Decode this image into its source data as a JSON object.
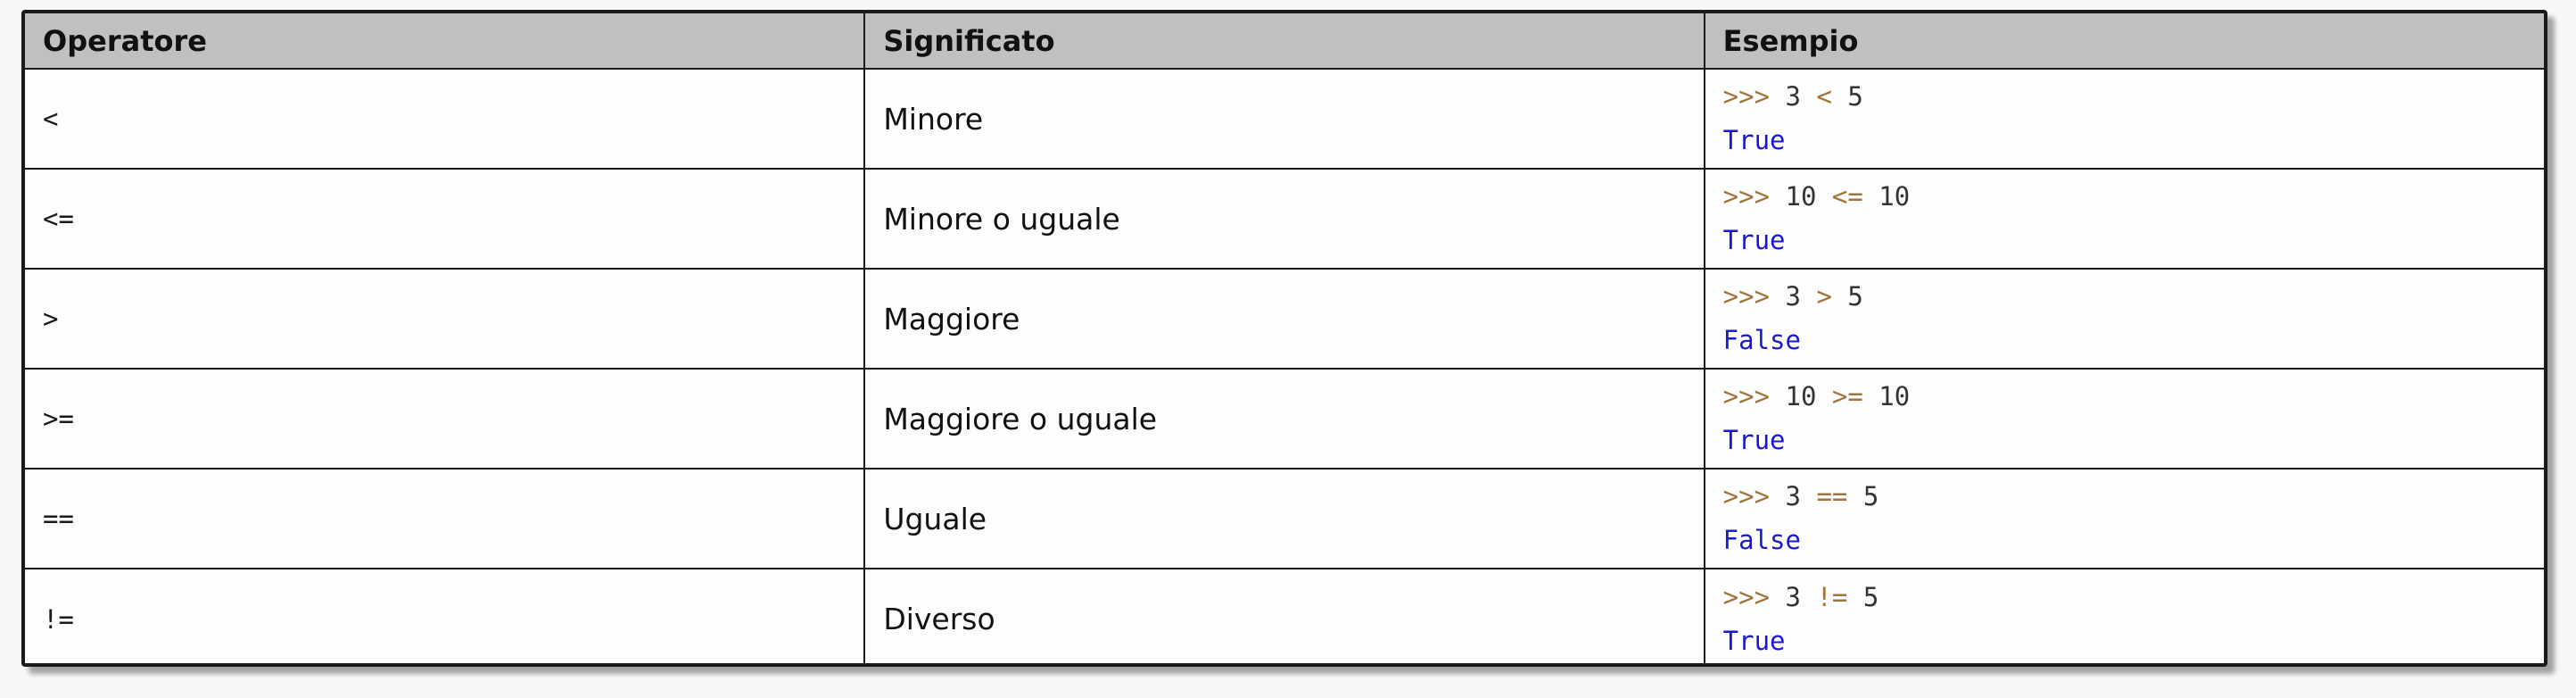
{
  "table": {
    "headers": [
      "Operatore",
      "Significato",
      "Esempio"
    ],
    "rows": [
      {
        "operator": "<",
        "meaning": "Minore",
        "prompt": ">>>",
        "left": "3",
        "op": "<",
        "right": "5",
        "result": "True"
      },
      {
        "operator": "<=",
        "meaning": "Minore o uguale",
        "prompt": ">>>",
        "left": "10",
        "op": "<=",
        "right": "10",
        "result": "True"
      },
      {
        "operator": ">",
        "meaning": "Maggiore",
        "prompt": ">>>",
        "left": "3",
        "op": ">",
        "right": "5",
        "result": "False"
      },
      {
        "operator": ">=",
        "meaning": "Maggiore o uguale",
        "prompt": ">>>",
        "left": "10",
        "op": ">=",
        "right": "10",
        "result": "True"
      },
      {
        "operator": "==",
        "meaning": "Uguale",
        "prompt": ">>>",
        "left": "3",
        "op": "==",
        "right": "5",
        "result": "False"
      },
      {
        "operator": "!=",
        "meaning": "Diverso",
        "prompt": ">>>",
        "left": "3",
        "op": "!=",
        "right": "5",
        "result": "True"
      }
    ]
  },
  "colors": {
    "header_bg": "#c0c0c0",
    "prompt": "#a0743a",
    "result": "#1a1acc",
    "border": "#1a1a1a"
  }
}
